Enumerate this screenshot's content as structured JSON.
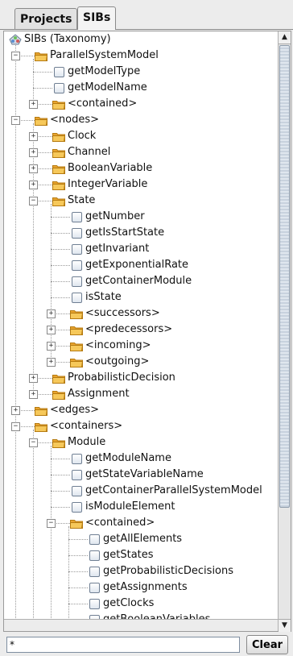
{
  "tabs": [
    {
      "label": "Projects",
      "active": false
    },
    {
      "label": "SIBs",
      "active": true
    }
  ],
  "tree": [
    {
      "label": "SIBs (Taxonomy)",
      "depth": 0,
      "kind": "root"
    },
    {
      "label": "ParallelSystemModel",
      "depth": 1,
      "kind": "folder",
      "expanded": true
    },
    {
      "label": "getModelType",
      "depth": 2,
      "kind": "leaf"
    },
    {
      "label": "getModelName",
      "depth": 2,
      "kind": "leaf"
    },
    {
      "label": "<contained>",
      "depth": 2,
      "kind": "folder",
      "expanded": false
    },
    {
      "label": "<nodes>",
      "depth": 1,
      "kind": "folder",
      "expanded": true
    },
    {
      "label": "Clock",
      "depth": 2,
      "kind": "folder",
      "expanded": false
    },
    {
      "label": "Channel",
      "depth": 2,
      "kind": "folder",
      "expanded": false
    },
    {
      "label": "BooleanVariable",
      "depth": 2,
      "kind": "folder",
      "expanded": false
    },
    {
      "label": "IntegerVariable",
      "depth": 2,
      "kind": "folder",
      "expanded": false
    },
    {
      "label": "State",
      "depth": 2,
      "kind": "folder",
      "expanded": true
    },
    {
      "label": "getNumber",
      "depth": 3,
      "kind": "leaf"
    },
    {
      "label": "getIsStartState",
      "depth": 3,
      "kind": "leaf"
    },
    {
      "label": "getInvariant",
      "depth": 3,
      "kind": "leaf"
    },
    {
      "label": "getExponentialRate",
      "depth": 3,
      "kind": "leaf"
    },
    {
      "label": "getContainerModule",
      "depth": 3,
      "kind": "leaf"
    },
    {
      "label": "isState",
      "depth": 3,
      "kind": "leaf"
    },
    {
      "label": "<successors>",
      "depth": 3,
      "kind": "folder",
      "expanded": false
    },
    {
      "label": "<predecessors>",
      "depth": 3,
      "kind": "folder",
      "expanded": false
    },
    {
      "label": "<incoming>",
      "depth": 3,
      "kind": "folder",
      "expanded": false
    },
    {
      "label": "<outgoing>",
      "depth": 3,
      "kind": "folder",
      "expanded": false
    },
    {
      "label": "ProbabilisticDecision",
      "depth": 2,
      "kind": "folder",
      "expanded": false
    },
    {
      "label": "Assignment",
      "depth": 2,
      "kind": "folder",
      "expanded": false
    },
    {
      "label": "<edges>",
      "depth": 1,
      "kind": "folder",
      "expanded": false
    },
    {
      "label": "<containers>",
      "depth": 1,
      "kind": "folder",
      "expanded": true
    },
    {
      "label": "Module",
      "depth": 2,
      "kind": "folder",
      "expanded": true
    },
    {
      "label": "getModuleName",
      "depth": 3,
      "kind": "leaf"
    },
    {
      "label": "getStateVariableName",
      "depth": 3,
      "kind": "leaf"
    },
    {
      "label": "getContainerParallelSystemModel",
      "depth": 3,
      "kind": "leaf"
    },
    {
      "label": "isModuleElement",
      "depth": 3,
      "kind": "leaf"
    },
    {
      "label": "<contained>",
      "depth": 3,
      "kind": "folder",
      "expanded": true
    },
    {
      "label": "getAllElements",
      "depth": 4,
      "kind": "leaf"
    },
    {
      "label": "getStates",
      "depth": 4,
      "kind": "leaf"
    },
    {
      "label": "getProbabilisticDecisions",
      "depth": 4,
      "kind": "leaf"
    },
    {
      "label": "getAssignments",
      "depth": 4,
      "kind": "leaf"
    },
    {
      "label": "getClocks",
      "depth": 4,
      "kind": "leaf"
    },
    {
      "label": "getBooleanVariables",
      "depth": 4,
      "kind": "leaf"
    }
  ],
  "scrollbar": {
    "up_arrow": "▲",
    "down_arrow": "▼"
  },
  "filter": {
    "value": "*"
  },
  "clear_button": {
    "label": "Clear"
  },
  "colors": {
    "folder": "#f0b43c",
    "folder_dark": "#c98a18",
    "leaf_border": "#6f7f93"
  }
}
